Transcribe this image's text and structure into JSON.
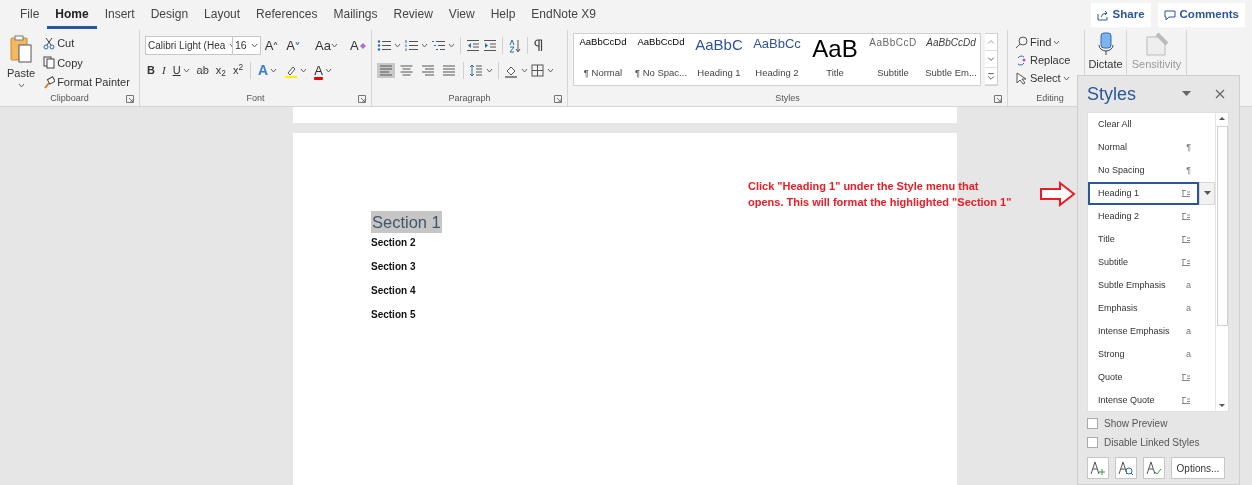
{
  "tabs": [
    {
      "label": "File",
      "selected": false
    },
    {
      "label": "Home",
      "selected": true
    },
    {
      "label": "Insert",
      "selected": false
    },
    {
      "label": "Design",
      "selected": false
    },
    {
      "label": "Layout",
      "selected": false
    },
    {
      "label": "References",
      "selected": false
    },
    {
      "label": "Mailings",
      "selected": false
    },
    {
      "label": "Review",
      "selected": false
    },
    {
      "label": "View",
      "selected": false
    },
    {
      "label": "Help",
      "selected": false
    },
    {
      "label": "EndNote X9",
      "selected": false
    }
  ],
  "share": {
    "label": "Share"
  },
  "comments": {
    "label": "Comments"
  },
  "clipboard": {
    "group": "Clipboard",
    "paste": "Paste",
    "items": [
      {
        "kind": "cut",
        "label": "Cut"
      },
      {
        "kind": "copy",
        "label": "Copy"
      },
      {
        "kind": "painter",
        "label": "Format Painter"
      }
    ]
  },
  "font": {
    "group": "Font",
    "name": "Calibri Light (Hea",
    "size": "16",
    "row1": [
      {
        "kind": "grow",
        "label": "A",
        "dropdown": false
      },
      {
        "kind": "shrink",
        "label": "A",
        "dropdown": false
      },
      {
        "kind": "case",
        "label": "Aa",
        "dropdown": true
      },
      {
        "kind": "clear",
        "label": "A",
        "dropdown": false
      }
    ],
    "row2": [
      {
        "kind": "bold",
        "label": "B",
        "dropdown": false
      },
      {
        "kind": "italic",
        "label": "I",
        "dropdown": false
      },
      {
        "kind": "underline",
        "label": "U",
        "dropdown": true
      },
      {
        "kind": "strike",
        "label": "ab",
        "dropdown": false
      },
      {
        "kind": "sub",
        "label": "x$_{2}$",
        "dropdown": false
      },
      {
        "kind": "sup",
        "label": "x$^{2}$",
        "dropdown": false
      },
      {
        "kind": "effects",
        "label": "A",
        "dropdown": true
      },
      {
        "kind": "highlight",
        "dropdown": true
      },
      {
        "kind": "color",
        "label": "A",
        "dropdown": true
      }
    ]
  },
  "paragraph": {
    "group": "Paragraph",
    "alignment": [
      {
        "kind": "left",
        "selected": true
      },
      {
        "kind": "center",
        "selected": false
      },
      {
        "kind": "right",
        "selected": false
      },
      {
        "kind": "justify",
        "selected": false
      }
    ]
  },
  "styles_gallery": {
    "group": "Styles",
    "items": [
      {
        "kind": "normal",
        "preview": "AaBbCcDd",
        "name": "¶ Normal"
      },
      {
        "kind": "normal",
        "preview": "AaBbCcDd",
        "name": "¶ No Spac..."
      },
      {
        "kind": "heading1",
        "preview": "AaBbC",
        "name": "Heading 1"
      },
      {
        "kind": "heading2",
        "preview": "AaBbCc",
        "name": "Heading 2"
      },
      {
        "kind": "title",
        "preview": "AaB",
        "name": "Title"
      },
      {
        "kind": "subtitle",
        "preview": "AaBbCcD",
        "name": "Subtitle"
      },
      {
        "kind": "subtle",
        "preview": "AaBbCcDd",
        "name": "Subtle Em..."
      }
    ]
  },
  "editing": {
    "group": "Editing",
    "items": [
      {
        "kind": "find",
        "label": "Find",
        "dropdown": true
      },
      {
        "kind": "replace",
        "label": "Replace",
        "dropdown": false
      },
      {
        "kind": "select",
        "label": "Select",
        "dropdown": true
      }
    ]
  },
  "voice": [
    {
      "kind": "dictate",
      "label": "Dictate",
      "disabled": false
    },
    {
      "kind": "sensitivity",
      "label": "Sensitivity",
      "disabled": true
    }
  ],
  "document": {
    "paragraphs": [
      {
        "kind": "heading1",
        "text": "Section 1",
        "selected": true
      },
      {
        "kind": "strong",
        "text": "Section 2",
        "selected": false
      },
      {
        "kind": "strong",
        "text": "Section 3",
        "selected": false
      },
      {
        "kind": "strong",
        "text": "Section 4",
        "selected": false
      },
      {
        "kind": "strong",
        "text": "Section 5",
        "selected": false
      }
    ]
  },
  "annotation": {
    "text": "Click \"Heading 1\" under the Style menu that\nopens. This will format the highlighted \"Section 1\""
  },
  "styles_pane": {
    "title": "Styles",
    "items": [
      {
        "label": "Clear All",
        "kind": "none",
        "selected": false
      },
      {
        "label": "Normal",
        "kind": "paragraph",
        "mark": "¶",
        "selected": false
      },
      {
        "label": "No Spacing",
        "kind": "paragraph",
        "mark": "¶",
        "selected": false
      },
      {
        "label": "Heading 1",
        "kind": "linked",
        "selected": true
      },
      {
        "label": "Heading 2",
        "kind": "linked",
        "selected": false
      },
      {
        "label": "Title",
        "kind": "linked",
        "selected": false
      },
      {
        "label": "Subtitle",
        "kind": "linked",
        "selected": false
      },
      {
        "label": "Subtle Emphasis",
        "kind": "character",
        "mark": "a",
        "selected": false
      },
      {
        "label": "Emphasis",
        "kind": "character",
        "mark": "a",
        "selected": false
      },
      {
        "label": "Intense Emphasis",
        "kind": "character",
        "mark": "a",
        "selected": false
      },
      {
        "label": "Strong",
        "kind": "character",
        "mark": "a",
        "selected": false
      },
      {
        "label": "Quote",
        "kind": "linked",
        "selected": false
      },
      {
        "label": "Intense Quote",
        "kind": "linked",
        "selected": false
      }
    ],
    "checkboxes": [
      {
        "label": "Show Preview",
        "checked": false
      },
      {
        "label": "Disable Linked Styles",
        "checked": false
      }
    ],
    "options_button": "Options..."
  }
}
